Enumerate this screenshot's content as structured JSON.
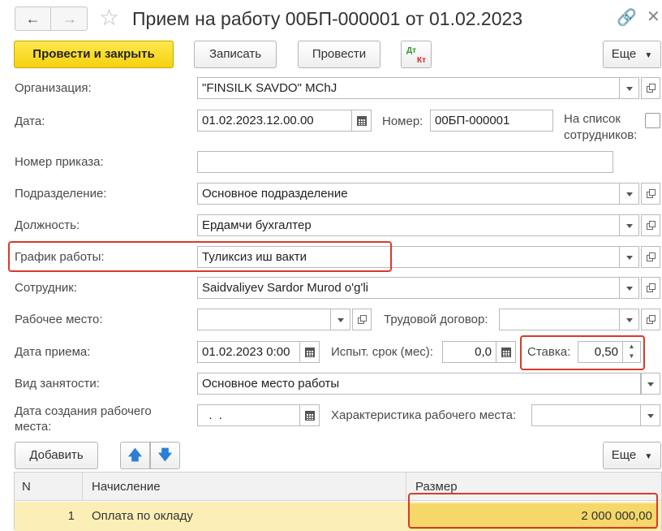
{
  "window": {
    "title": "Прием на работу 00БП-000001 от 01.02.2023"
  },
  "toolbar": {
    "post_close": "Провести и закрыть",
    "save": "Записать",
    "post": "Провести",
    "dt_label": "Дт",
    "kt_label": "Кт",
    "more": "Еще"
  },
  "form": {
    "organization": {
      "label": "Организация:",
      "value": "\"FINSILK  SAVDO\" MChJ"
    },
    "date": {
      "label": "Дата:",
      "value": "01.02.2023.12.00.00"
    },
    "number": {
      "label": "Номер:",
      "value": "00БП-000001"
    },
    "on_staff_list": {
      "label": "На список сотрудников:",
      "checked": false
    },
    "order_number": {
      "label": "Номер приказа:",
      "value": ""
    },
    "department": {
      "label": "Подразделение:",
      "value": "Основное подразделение"
    },
    "position": {
      "label": "Должность:",
      "value": "Ердамчи бухгалтер"
    },
    "schedule": {
      "label": "График работы:",
      "value": "Туликсиз иш вакти"
    },
    "employee": {
      "label": "Сотрудник:",
      "value": "Saidvaliyev Sardor Murod o'g'li"
    },
    "workplace": {
      "label": "Рабочее место:",
      "value": ""
    },
    "labor_contract": {
      "label": "Трудовой договор:",
      "value": ""
    },
    "hire_date": {
      "label": "Дата приема:",
      "value": "01.02.2023  0:00"
    },
    "probation": {
      "label": "Испыт. срок (мес):",
      "value": "0,0"
    },
    "rate": {
      "label": "Ставка:",
      "value": "0,50"
    },
    "employment_type": {
      "label": "Вид занятости:",
      "value": "Основное место работы"
    },
    "workplace_created": {
      "label": "Дата создания рабочего места:",
      "value": "  .  ."
    },
    "workplace_characteristic": {
      "label": "Характеристика рабочего места:",
      "value": ""
    }
  },
  "accruals": {
    "add_label": "Добавить",
    "more": "Еще",
    "columns": [
      "N",
      "Начисление",
      "Размер"
    ],
    "rows": [
      {
        "n": "1",
        "accrual": "Оплата по окладу",
        "amount": "2 000 000,00"
      }
    ]
  },
  "colors": {
    "primary_button": "#f5d20f",
    "highlight": "#d93a2b",
    "selected_row": "#fbefb7"
  }
}
